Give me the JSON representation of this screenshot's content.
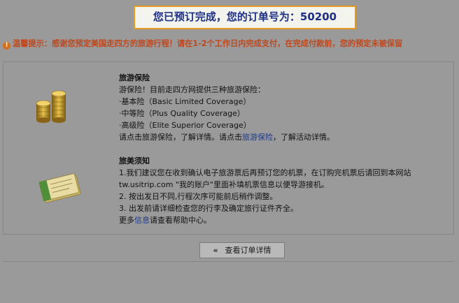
{
  "order": {
    "confirmation": "您已预订完成，您的订单号为：50200"
  },
  "notice": {
    "icon": "warning-icon",
    "text": "温馨提示：感谢您预定美国走四方的旅游行程！请在1-2个工作日内完成支付，在完成付款前，您的预定未被保留"
  },
  "insurance": {
    "icon": "coins-icon",
    "title": "旅游保险",
    "intro": "游保险！目前走四方网提供三种旅游保险：",
    "options": [
      "·基本险（Basic Limited Coverage）",
      "·中等险（Plus Quality Coverage）",
      "·高级险（Elite Superior Coverage）"
    ],
    "footer_prefix": "请点击旅游保险，了解详情。请点击",
    "footer_link": "旅游保险",
    "footer_suffix": "，了解活动详情。"
  },
  "travel": {
    "icon": "ticket-icon",
    "title": "旅美须知",
    "items": [
      "1.我们建议您在收到确认电子旅游票后再预订您的机票，在订购完机票后请回到本网站",
      "tw.usitrip.com \"我的账户\"里面补填机票信息以便导游接机。",
      "2. 按出发日不同,行程次序可能前后稍作调整。",
      "3. 出发前请详细检查您的行李及确定旅行证件齐全。"
    ],
    "more_prefix": "更多",
    "more_link": "信息",
    "more_suffix": "请查看帮助中心。"
  },
  "actions": {
    "view_order_arrow": "«",
    "view_order_label": "查看订单详情"
  },
  "colors": {
    "confirm_border": "#e89a1c",
    "confirm_text": "#1d2f85",
    "notice_text": "#c0471c",
    "link": "#1f3a86"
  }
}
